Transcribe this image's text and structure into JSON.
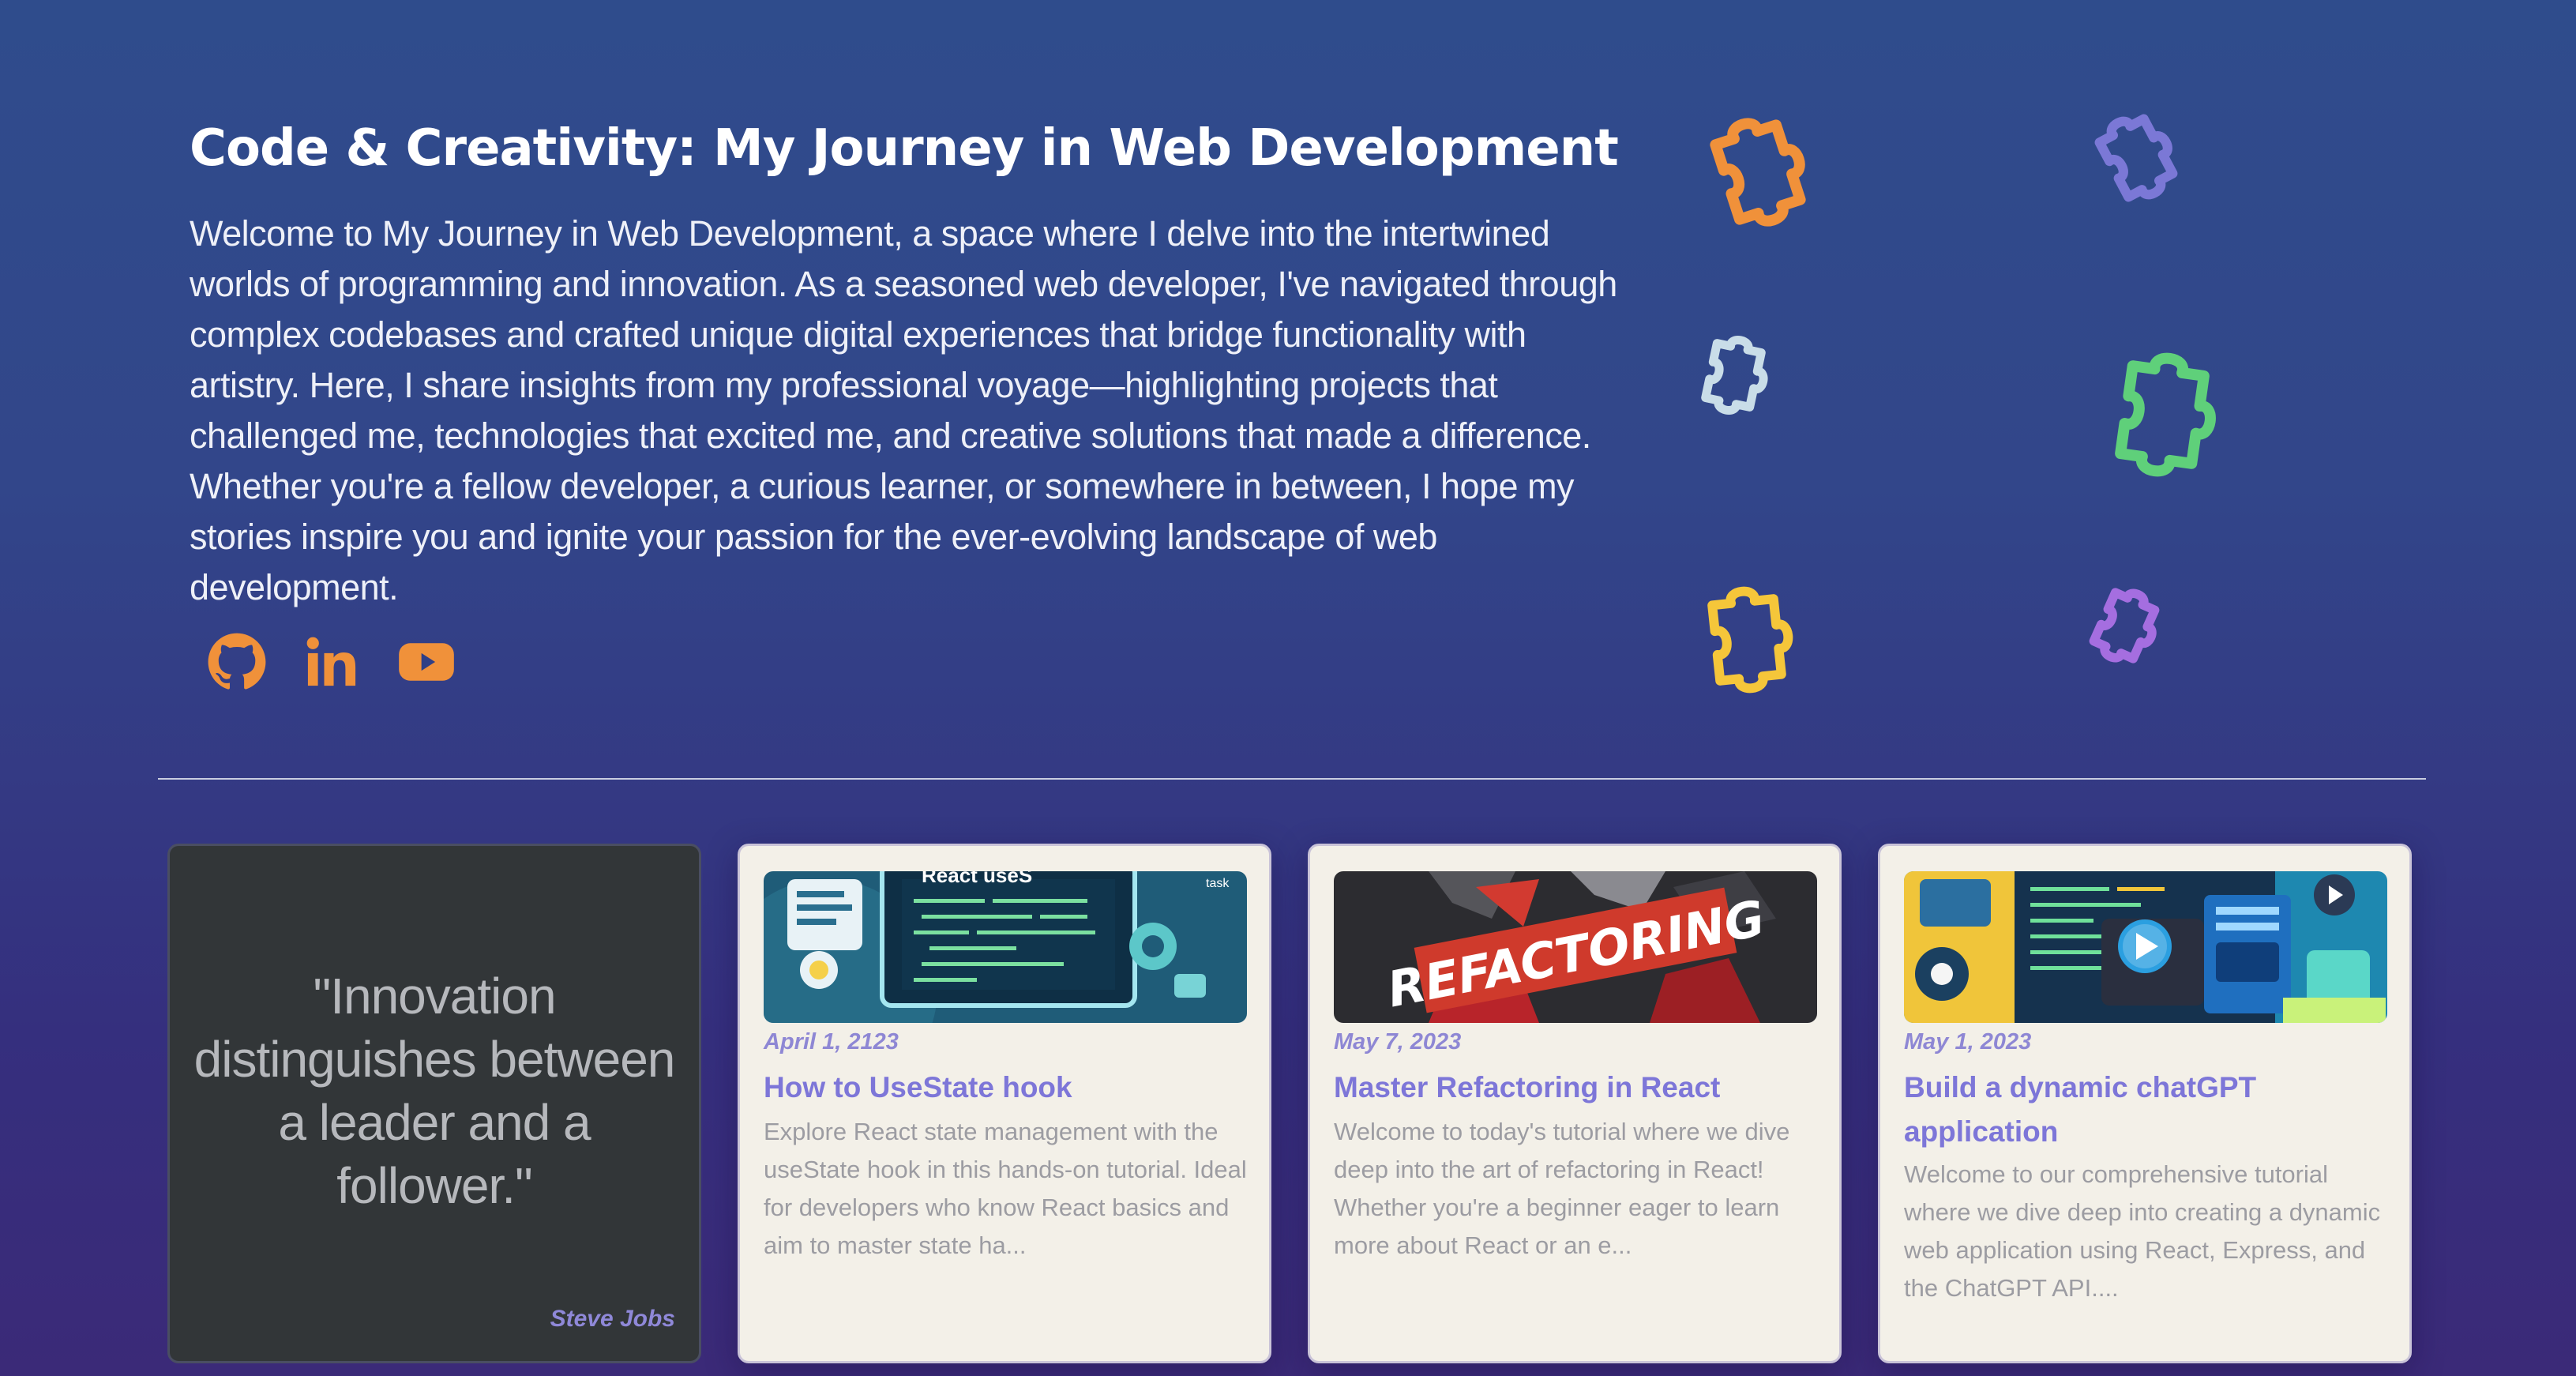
{
  "hero": {
    "title": "Code & Creativity: My Journey in Web Development",
    "intro": "Welcome to My Journey in Web Development, a space where I delve into the intertwined worlds of programming and innovation. As a seasoned web developer, I've navigated through complex codebases and crafted unique digital experiences that bridge functionality with artistry. Here, I share insights from my professional voyage—highlighting projects that challenged me, technologies that excited me, and creative solutions that made a difference. Whether you're a fellow developer, a curious learner, or somewhere in between, I hope my stories inspire you and ignite your passion for the ever-evolving landscape of web development."
  },
  "socials": [
    {
      "icon": "github-icon"
    },
    {
      "icon": "linkedin-icon"
    },
    {
      "icon": "youtube-icon"
    }
  ],
  "decor": {
    "puzzle_icon": "puzzle-piece-icon",
    "puzzle_colors": [
      "#f0913a",
      "#7b78d6",
      "#c9dde8",
      "#5fd07a",
      "#f5c63a",
      "#a56ee0"
    ]
  },
  "quote": {
    "text": "\"Innovation distinguishes between a leader and a follower.\"",
    "author": "Steve Jobs"
  },
  "posts": [
    {
      "image_text": "React useS",
      "date": "April 1, 2123",
      "title": "How to UseState hook",
      "excerpt": "Explore React state management with the useState hook in this hands-on tutorial. Ideal for developers who know React basics and aim to master state ha..."
    },
    {
      "image_text": "REFACTORING",
      "date": "May 7, 2023",
      "title": "Master Refactoring in React",
      "excerpt": "Welcome to today's tutorial where we dive deep into the art of refactoring in React! Whether you're a beginner eager to learn more about React or an e..."
    },
    {
      "image_text": "",
      "date": "May 1, 2023",
      "title": "Build a dynamic chatGPT application",
      "excerpt": "Welcome to our comprehensive tutorial where we dive deep into creating a dynamic web application using React, Express, and the ChatGPT API...."
    }
  ],
  "colors": {
    "accent_orange": "#f0913a",
    "link_purple": "#7d76d8",
    "card_bg": "#f3f0e8",
    "quote_bg": "#323638"
  }
}
